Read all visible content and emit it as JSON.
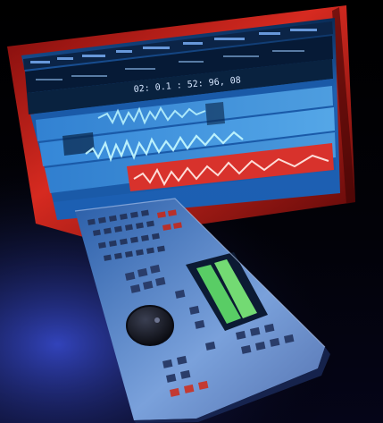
{
  "photo": {
    "subject": "",
    "timecode": "02: 0.1 : 52: 96, 08",
    "colors": {
      "background_black": "#000000",
      "bezel_red": "#c4201a",
      "screen_blue": "#2e8fe0",
      "waveform_cyan": "#9ff5ff",
      "clip_red": "#d8322c",
      "console_blue": "#5b82c8",
      "meter_green": "#62e16a"
    },
    "icons": {
      "jog_wheel": "jog-wheel-icon"
    }
  }
}
